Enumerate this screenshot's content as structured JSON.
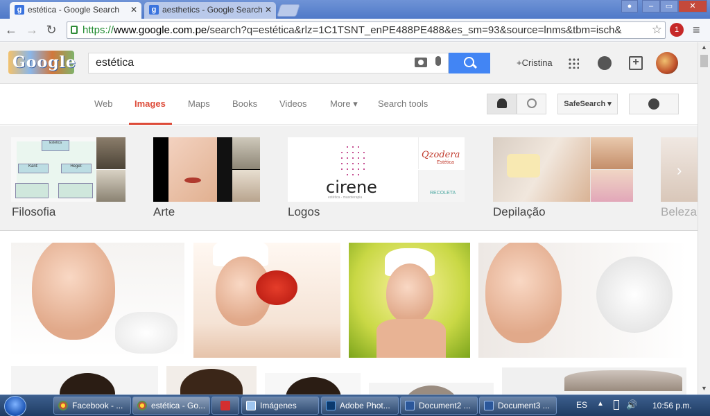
{
  "browser": {
    "tabs": [
      {
        "title": "estética - Google Search",
        "favicon": "google-g-icon"
      },
      {
        "title": "aesthetics - Google Search",
        "favicon": "google-g-icon"
      }
    ],
    "url": {
      "protocol": "https://",
      "host": "www.google.com.pe",
      "path": "/search?q=estética&rlz=1C1TSNT_enPE488PE488&es_sm=93&source=lnms&tbm=isch&"
    },
    "extension_badge": "1"
  },
  "google": {
    "logo_text": "Google",
    "query": "estética",
    "user_link": "+Cristina",
    "nav": [
      {
        "label": "Web"
      },
      {
        "label": "Images"
      },
      {
        "label": "Maps"
      },
      {
        "label": "Books"
      },
      {
        "label": "Videos"
      },
      {
        "label": "More ▾"
      },
      {
        "label": "Search tools"
      }
    ],
    "safesearch_label": "SafeSearch ▾",
    "accent_color": "#dd4b39",
    "search_button_color": "#4285f4"
  },
  "related": [
    {
      "label": "Filosofia",
      "thumb_text": [
        "Estetica",
        "Kant:",
        "Hegel:"
      ]
    },
    {
      "label": "Arte"
    },
    {
      "label": "Logos",
      "thumb_text": [
        "cirene",
        "estética - masoterapia",
        "Qzodera",
        "Estética",
        "RECOLETA"
      ]
    },
    {
      "label": "Depilação"
    },
    {
      "label": "Beleza"
    }
  ],
  "taskbar": {
    "items": [
      {
        "label": "Facebook - ..."
      },
      {
        "label": "estética - Go..."
      },
      {
        "label": ""
      },
      {
        "label": "Imágenes"
      },
      {
        "label": "Adobe Phot..."
      },
      {
        "label": "Document2 ..."
      },
      {
        "label": "Document3 ..."
      }
    ],
    "language": "ES",
    "clock": "10:56 p.m."
  }
}
